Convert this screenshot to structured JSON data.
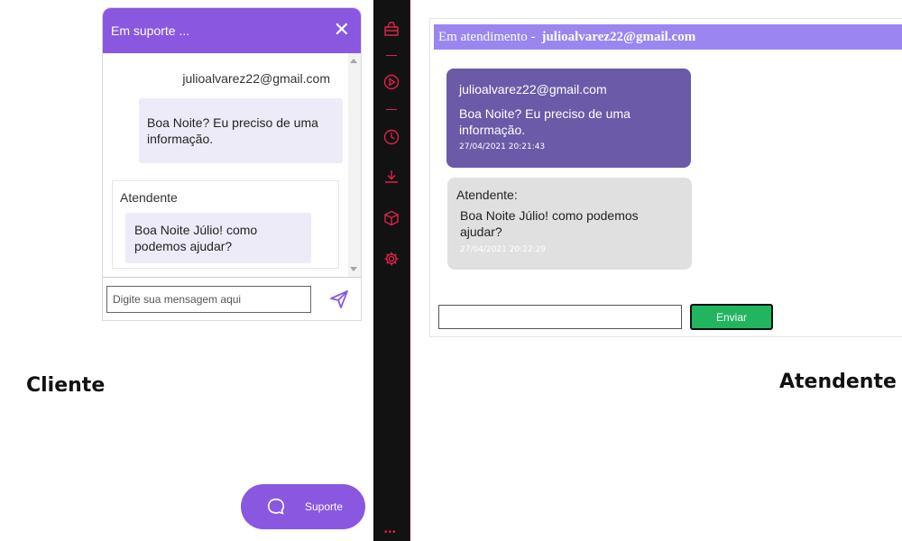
{
  "colors": {
    "brand_purple": "#8a57e0",
    "client_bubble": "#eeebf9",
    "agent_header": "#9b86f0",
    "agent_client_msg": "#6b5aa8",
    "agent_reply_bg": "#e0e0e0",
    "send_green": "#22b560",
    "sidebar_bg": "#121212",
    "sidebar_accent": "#e0224a"
  },
  "client": {
    "header_title": "Em suporte ...",
    "close_icon": "close-icon",
    "email": "julioalvarez22@gmail.com",
    "client_message": "Boa Noite? Eu preciso de uma informação.",
    "agent_title": "Atendente",
    "agent_message": "Boa Noite Júlio! como podemos ajudar?",
    "input_placeholder": "Digite sua mensagem aqui",
    "send_icon": "send-icon",
    "label": "Cliente"
  },
  "support_button": {
    "label": "Suporte",
    "icon": "chat-bubble-icon"
  },
  "sidebar": {
    "icons": [
      "inbox-icon",
      "play-icon",
      "clock-icon",
      "download-icon",
      "cube-icon",
      "gear-icon"
    ],
    "more": "•••"
  },
  "agent": {
    "header_prefix": "Em atendimento -",
    "header_email": "julioalvarez22@gmail.com",
    "client_msg": {
      "email": "julioalvarez22@gmail.com",
      "text": "Boa Noite? Eu preciso de uma informação.",
      "time": "27/04/2021 20:21:43"
    },
    "agent_msg": {
      "who": "Atendente:",
      "text": "Boa Noite Júlio! como podemos ajudar?",
      "time": "27/04/2021 20:22:29"
    },
    "input_value": "",
    "send_label": "Enviar",
    "label": "Atendente"
  }
}
